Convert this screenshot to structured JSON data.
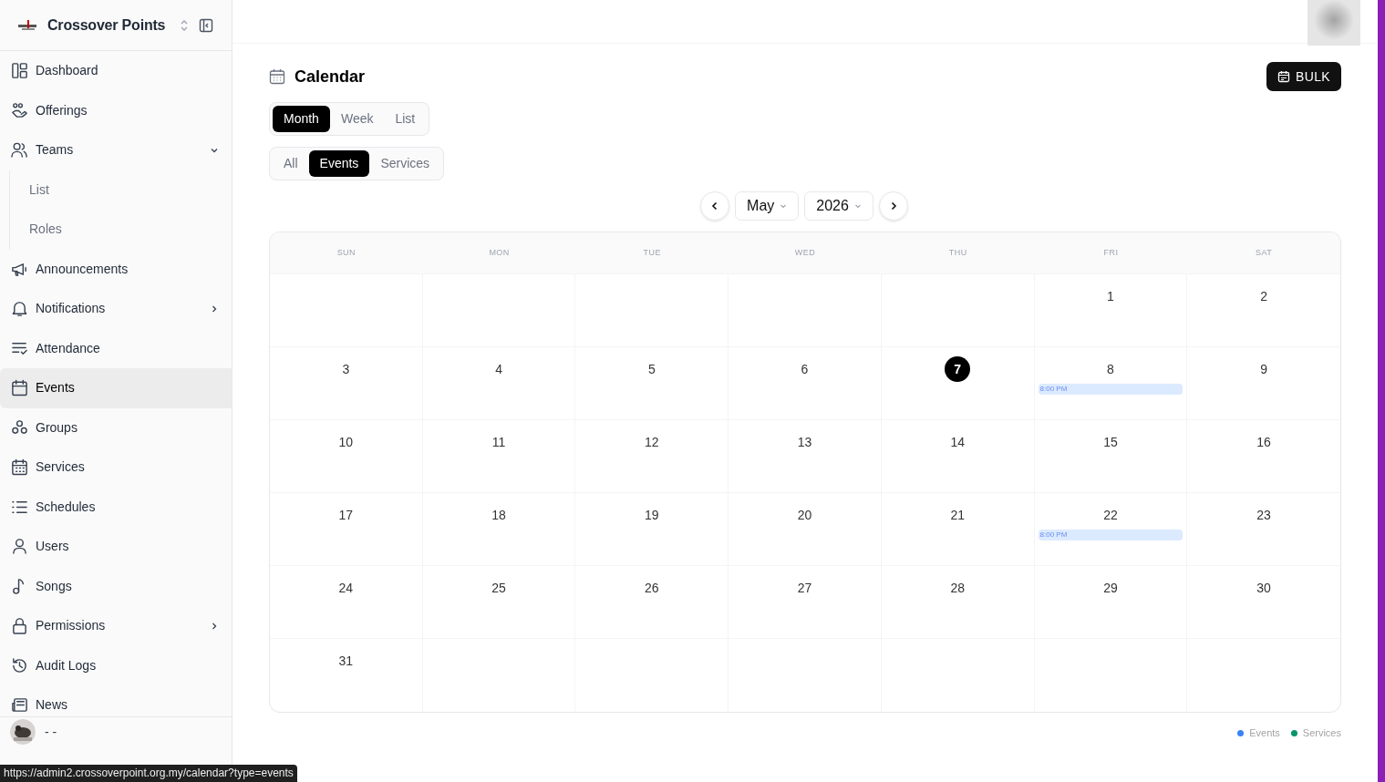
{
  "sidebar": {
    "brand": "Crossover Points",
    "items": [
      {
        "label": "Dashboard",
        "selected": false
      },
      {
        "label": "Offerings",
        "selected": false
      },
      {
        "label": "Teams",
        "selected": false,
        "expanded": true,
        "children": [
          {
            "label": "List",
            "selected": false
          },
          {
            "label": "Roles",
            "selected": false
          }
        ]
      },
      {
        "label": "Announcements",
        "selected": false
      },
      {
        "label": "Notifications",
        "selected": false,
        "expanded": false
      },
      {
        "label": "Attendance",
        "selected": false
      },
      {
        "label": "Events",
        "selected": true
      },
      {
        "label": "Groups",
        "selected": false
      },
      {
        "label": "Services",
        "selected": false
      },
      {
        "label": "Schedules",
        "selected": false
      },
      {
        "label": "Users",
        "selected": false
      },
      {
        "label": "Songs",
        "selected": false
      },
      {
        "label": "Permissions",
        "selected": false,
        "expanded": false
      },
      {
        "label": "Audit Logs",
        "selected": false
      },
      {
        "label": "News",
        "selected": false
      }
    ],
    "user": {
      "name": "- -"
    }
  },
  "status_link": "https://admin2.crossoverpoint.org.my/calendar?type=events",
  "page": {
    "title": "Calendar",
    "bulk_button": "BULK",
    "views": [
      {
        "label": "Month",
        "selected": true
      },
      {
        "label": "Week",
        "selected": false
      },
      {
        "label": "List",
        "selected": false
      }
    ],
    "filters": [
      {
        "label": "All",
        "selected": false
      },
      {
        "label": "Events",
        "selected": true
      },
      {
        "label": "Services",
        "selected": false
      }
    ],
    "month": "May",
    "year": "2026",
    "weekdays": [
      "SUN",
      "MON",
      "TUE",
      "WED",
      "THU",
      "FRI",
      "SAT"
    ],
    "weeks": [
      [
        {
          "day": "1",
          "today": false
        },
        {
          "day": "2",
          "today": false
        }
      ],
      [
        {
          "day": "3",
          "today": false
        },
        {
          "day": "4",
          "today": false
        },
        {
          "day": "5",
          "today": false
        },
        {
          "day": "6",
          "today": false
        },
        {
          "day": "7",
          "today": true
        },
        {
          "day": "8",
          "today": false,
          "events": [
            {
              "time": "8:00 PM",
              "color": "#dbeafe"
            }
          ]
        },
        {
          "day": "9",
          "today": false
        }
      ],
      [
        {
          "day": "10",
          "today": false
        },
        {
          "day": "11",
          "today": false
        },
        {
          "day": "12",
          "today": false
        },
        {
          "day": "13",
          "today": false
        },
        {
          "day": "14",
          "today": false
        },
        {
          "day": "15",
          "today": false
        },
        {
          "day": "16",
          "today": false
        }
      ],
      [
        {
          "day": "17",
          "today": false
        },
        {
          "day": "18",
          "today": false
        },
        {
          "day": "19",
          "today": false
        },
        {
          "day": "20",
          "today": false
        },
        {
          "day": "21",
          "today": false
        },
        {
          "day": "22",
          "today": false,
          "events": [
            {
              "time": "8:00 PM",
              "color": "#dbeafe"
            }
          ]
        },
        {
          "day": "23",
          "today": false
        }
      ],
      [
        {
          "day": "24",
          "today": false
        },
        {
          "day": "25",
          "today": false
        },
        {
          "day": "26",
          "today": false
        },
        {
          "day": "27",
          "today": false
        },
        {
          "day": "28",
          "today": false
        },
        {
          "day": "29",
          "today": false
        },
        {
          "day": "30",
          "today": false
        }
      ],
      [
        {
          "day": "31",
          "today": false
        }
      ]
    ],
    "legend": [
      {
        "label": "Events",
        "color": "#3b82f6"
      },
      {
        "label": "Services",
        "color": "#059669"
      }
    ]
  }
}
